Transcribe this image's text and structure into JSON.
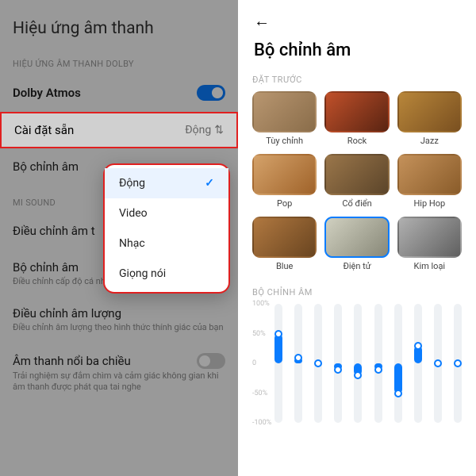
{
  "left": {
    "title": "Hiệu ứng âm thanh",
    "dolby_section": "HIỆU ỨNG ÂM THANH DOLBY",
    "dolby_label": "Dolby Atmos",
    "preset_label": "Cài đặt sẵn",
    "preset_value": "Động",
    "eq_label": "Bộ chỉnh âm",
    "misound_section": "MI SOUND",
    "tune_label": "Điều chỉnh âm t",
    "eq2_label": "Bộ chỉnh âm",
    "eq2_sub": "Điều chỉnh cấp độ cá nhân cho các loại hình âm nhạc",
    "vol_label": "Điều chỉnh âm lượng",
    "vol_sub": "Điều chỉnh âm lượng theo hình thức thính giác của bạn",
    "spatial_label": "Âm thanh nổi ba chiều",
    "spatial_sub": "Trải nghiệm sự đắm chìm và cảm giác không gian khi âm thanh được phát qua tai nghe"
  },
  "popup": {
    "items": [
      "Động",
      "Video",
      "Nhạc",
      "Giọng nói"
    ],
    "selected": "Động"
  },
  "right": {
    "title": "Bộ chỉnh âm",
    "presets_section": "ĐẶT TRƯỚC",
    "cards": [
      "Tùy chỉnh",
      "Rock",
      "Jazz",
      "Pop",
      "Cổ điển",
      "Hip Hop",
      "Blue",
      "Điện tử",
      "Kim loại"
    ],
    "selected_card": "Điện tử",
    "eq_section": "BỘ CHỈNH ÂM",
    "yticks": [
      "100%",
      "50%",
      "0",
      "-50%",
      "-100%"
    ]
  },
  "chart_data": {
    "type": "bar",
    "title": "BỘ CHỈNH ÂM",
    "ylabel": "%",
    "ylim": [
      -100,
      100
    ],
    "categories": [
      "b1",
      "b2",
      "b3",
      "b4",
      "b5",
      "b6",
      "b7",
      "b8",
      "b9",
      "b10"
    ],
    "values": [
      50,
      10,
      0,
      -10,
      -20,
      -10,
      -50,
      30,
      0,
      0
    ]
  }
}
